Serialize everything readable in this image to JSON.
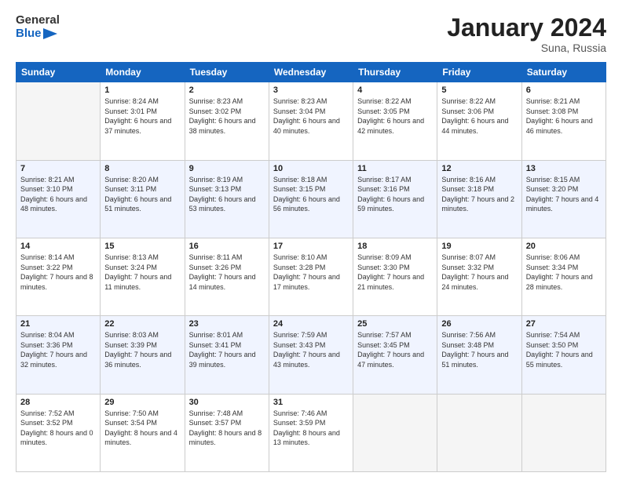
{
  "header": {
    "logo_line1": "General",
    "logo_line2": "Blue",
    "month_title": "January 2024",
    "location": "Suna, Russia"
  },
  "weekdays": [
    "Sunday",
    "Monday",
    "Tuesday",
    "Wednesday",
    "Thursday",
    "Friday",
    "Saturday"
  ],
  "weeks": [
    [
      {
        "day": "",
        "sunrise": "",
        "sunset": "",
        "daylight": ""
      },
      {
        "day": "1",
        "sunrise": "Sunrise: 8:24 AM",
        "sunset": "Sunset: 3:01 PM",
        "daylight": "Daylight: 6 hours and 37 minutes."
      },
      {
        "day": "2",
        "sunrise": "Sunrise: 8:23 AM",
        "sunset": "Sunset: 3:02 PM",
        "daylight": "Daylight: 6 hours and 38 minutes."
      },
      {
        "day": "3",
        "sunrise": "Sunrise: 8:23 AM",
        "sunset": "Sunset: 3:04 PM",
        "daylight": "Daylight: 6 hours and 40 minutes."
      },
      {
        "day": "4",
        "sunrise": "Sunrise: 8:22 AM",
        "sunset": "Sunset: 3:05 PM",
        "daylight": "Daylight: 6 hours and 42 minutes."
      },
      {
        "day": "5",
        "sunrise": "Sunrise: 8:22 AM",
        "sunset": "Sunset: 3:06 PM",
        "daylight": "Daylight: 6 hours and 44 minutes."
      },
      {
        "day": "6",
        "sunrise": "Sunrise: 8:21 AM",
        "sunset": "Sunset: 3:08 PM",
        "daylight": "Daylight: 6 hours and 46 minutes."
      }
    ],
    [
      {
        "day": "7",
        "sunrise": "Sunrise: 8:21 AM",
        "sunset": "Sunset: 3:10 PM",
        "daylight": "Daylight: 6 hours and 48 minutes."
      },
      {
        "day": "8",
        "sunrise": "Sunrise: 8:20 AM",
        "sunset": "Sunset: 3:11 PM",
        "daylight": "Daylight: 6 hours and 51 minutes."
      },
      {
        "day": "9",
        "sunrise": "Sunrise: 8:19 AM",
        "sunset": "Sunset: 3:13 PM",
        "daylight": "Daylight: 6 hours and 53 minutes."
      },
      {
        "day": "10",
        "sunrise": "Sunrise: 8:18 AM",
        "sunset": "Sunset: 3:15 PM",
        "daylight": "Daylight: 6 hours and 56 minutes."
      },
      {
        "day": "11",
        "sunrise": "Sunrise: 8:17 AM",
        "sunset": "Sunset: 3:16 PM",
        "daylight": "Daylight: 6 hours and 59 minutes."
      },
      {
        "day": "12",
        "sunrise": "Sunrise: 8:16 AM",
        "sunset": "Sunset: 3:18 PM",
        "daylight": "Daylight: 7 hours and 2 minutes."
      },
      {
        "day": "13",
        "sunrise": "Sunrise: 8:15 AM",
        "sunset": "Sunset: 3:20 PM",
        "daylight": "Daylight: 7 hours and 4 minutes."
      }
    ],
    [
      {
        "day": "14",
        "sunrise": "Sunrise: 8:14 AM",
        "sunset": "Sunset: 3:22 PM",
        "daylight": "Daylight: 7 hours and 8 minutes."
      },
      {
        "day": "15",
        "sunrise": "Sunrise: 8:13 AM",
        "sunset": "Sunset: 3:24 PM",
        "daylight": "Daylight: 7 hours and 11 minutes."
      },
      {
        "day": "16",
        "sunrise": "Sunrise: 8:11 AM",
        "sunset": "Sunset: 3:26 PM",
        "daylight": "Daylight: 7 hours and 14 minutes."
      },
      {
        "day": "17",
        "sunrise": "Sunrise: 8:10 AM",
        "sunset": "Sunset: 3:28 PM",
        "daylight": "Daylight: 7 hours and 17 minutes."
      },
      {
        "day": "18",
        "sunrise": "Sunrise: 8:09 AM",
        "sunset": "Sunset: 3:30 PM",
        "daylight": "Daylight: 7 hours and 21 minutes."
      },
      {
        "day": "19",
        "sunrise": "Sunrise: 8:07 AM",
        "sunset": "Sunset: 3:32 PM",
        "daylight": "Daylight: 7 hours and 24 minutes."
      },
      {
        "day": "20",
        "sunrise": "Sunrise: 8:06 AM",
        "sunset": "Sunset: 3:34 PM",
        "daylight": "Daylight: 7 hours and 28 minutes."
      }
    ],
    [
      {
        "day": "21",
        "sunrise": "Sunrise: 8:04 AM",
        "sunset": "Sunset: 3:36 PM",
        "daylight": "Daylight: 7 hours and 32 minutes."
      },
      {
        "day": "22",
        "sunrise": "Sunrise: 8:03 AM",
        "sunset": "Sunset: 3:39 PM",
        "daylight": "Daylight: 7 hours and 36 minutes."
      },
      {
        "day": "23",
        "sunrise": "Sunrise: 8:01 AM",
        "sunset": "Sunset: 3:41 PM",
        "daylight": "Daylight: 7 hours and 39 minutes."
      },
      {
        "day": "24",
        "sunrise": "Sunrise: 7:59 AM",
        "sunset": "Sunset: 3:43 PM",
        "daylight": "Daylight: 7 hours and 43 minutes."
      },
      {
        "day": "25",
        "sunrise": "Sunrise: 7:57 AM",
        "sunset": "Sunset: 3:45 PM",
        "daylight": "Daylight: 7 hours and 47 minutes."
      },
      {
        "day": "26",
        "sunrise": "Sunrise: 7:56 AM",
        "sunset": "Sunset: 3:48 PM",
        "daylight": "Daylight: 7 hours and 51 minutes."
      },
      {
        "day": "27",
        "sunrise": "Sunrise: 7:54 AM",
        "sunset": "Sunset: 3:50 PM",
        "daylight": "Daylight: 7 hours and 55 minutes."
      }
    ],
    [
      {
        "day": "28",
        "sunrise": "Sunrise: 7:52 AM",
        "sunset": "Sunset: 3:52 PM",
        "daylight": "Daylight: 8 hours and 0 minutes."
      },
      {
        "day": "29",
        "sunrise": "Sunrise: 7:50 AM",
        "sunset": "Sunset: 3:54 PM",
        "daylight": "Daylight: 8 hours and 4 minutes."
      },
      {
        "day": "30",
        "sunrise": "Sunrise: 7:48 AM",
        "sunset": "Sunset: 3:57 PM",
        "daylight": "Daylight: 8 hours and 8 minutes."
      },
      {
        "day": "31",
        "sunrise": "Sunrise: 7:46 AM",
        "sunset": "Sunset: 3:59 PM",
        "daylight": "Daylight: 8 hours and 13 minutes."
      },
      {
        "day": "",
        "sunrise": "",
        "sunset": "",
        "daylight": ""
      },
      {
        "day": "",
        "sunrise": "",
        "sunset": "",
        "daylight": ""
      },
      {
        "day": "",
        "sunrise": "",
        "sunset": "",
        "daylight": ""
      }
    ]
  ]
}
